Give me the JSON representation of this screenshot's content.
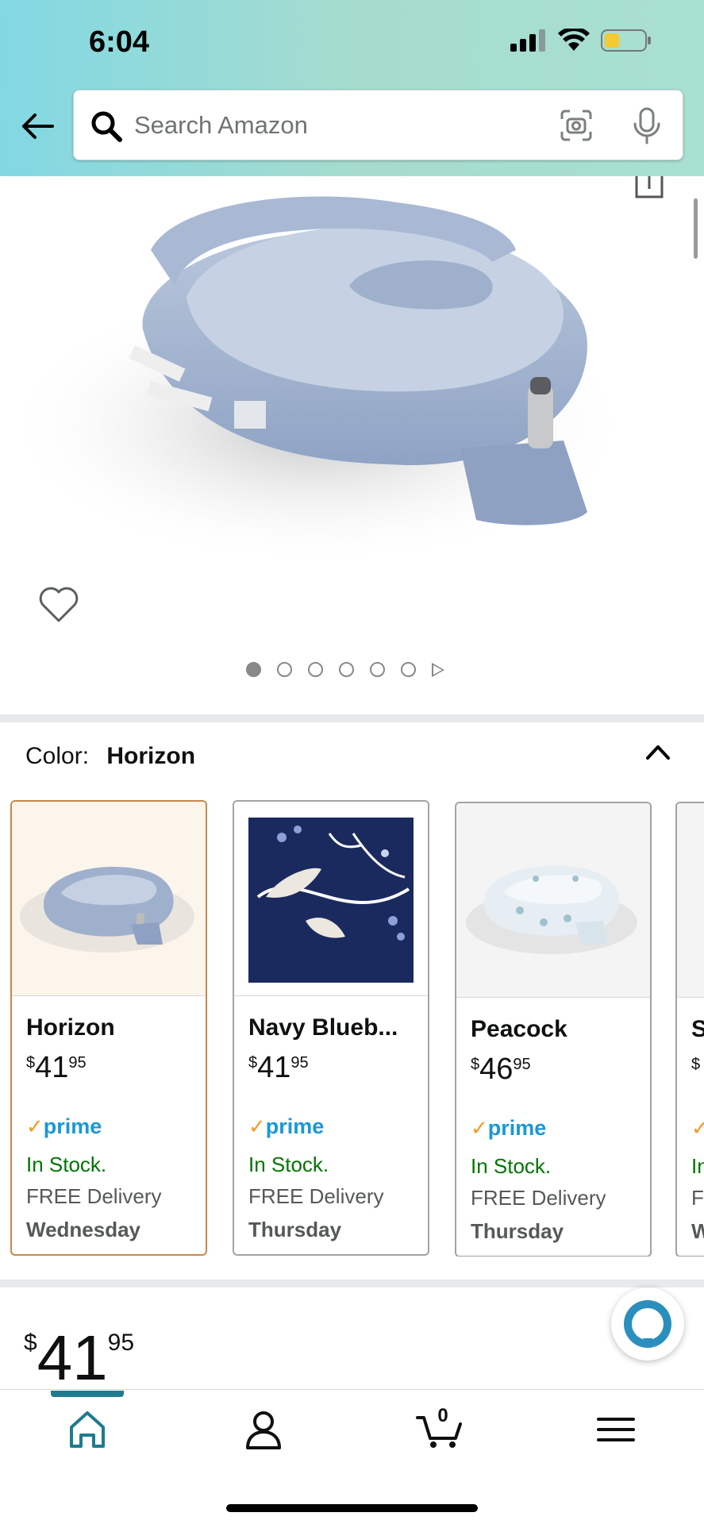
{
  "status_bar": {
    "time": "6:04"
  },
  "search": {
    "placeholder": "Search Amazon"
  },
  "product": {
    "image_count": 6,
    "active_image_index": 0
  },
  "color_section": {
    "label": "Color:",
    "selected_value": "Horizon",
    "options": [
      {
        "name": "Horizon",
        "currency": "$",
        "whole": "41",
        "fraction": "95",
        "prime": "prime",
        "stock": "In Stock.",
        "delivery": "FREE Delivery",
        "day": "Wednesday"
      },
      {
        "name": "Navy Blueb...",
        "currency": "$",
        "whole": "41",
        "fraction": "95",
        "prime": "prime",
        "stock": "In Stock.",
        "delivery": "FREE Delivery",
        "day": "Thursday"
      },
      {
        "name": "Peacock",
        "currency": "$",
        "whole": "46",
        "fraction": "95",
        "prime": "prime",
        "stock": "In Stock.",
        "delivery": "FREE Delivery",
        "day": "Thursday"
      },
      {
        "name": "S",
        "currency": "$",
        "whole": "",
        "fraction": "",
        "prime": "",
        "stock": "In",
        "delivery": "F",
        "day": "W"
      }
    ]
  },
  "price": {
    "currency": "$",
    "whole": "41",
    "fraction": "95"
  },
  "bottom_nav": {
    "items": [
      "home-icon",
      "account-icon",
      "cart-icon",
      "menu-icon"
    ],
    "cart_count": "0"
  },
  "colors": {
    "header_gradient_start": "#82d8e3",
    "header_gradient_end": "#a8e0d2",
    "accent_teal": "#1f7b8f",
    "prime_blue": "#1a98d5",
    "in_stock_green": "#007600",
    "selected_border": "#c9874a"
  }
}
